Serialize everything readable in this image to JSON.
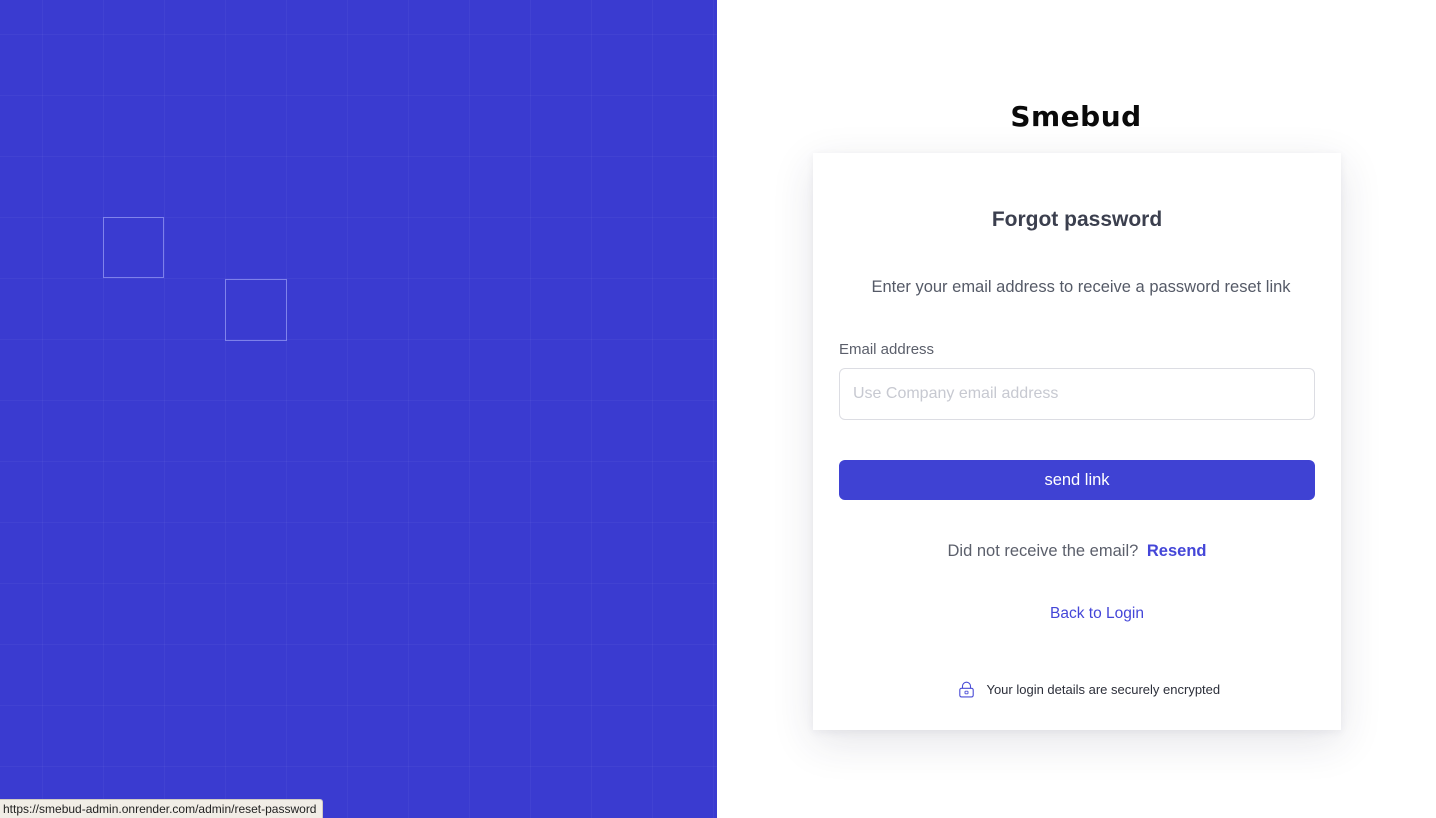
{
  "left_panel": {
    "status_url": "https://smebud-admin.onrender.com/admin/reset-password"
  },
  "brand": {
    "name": "Smebud"
  },
  "card": {
    "title": "Forgot password",
    "subtitle": "Enter your email address to receive a password reset link",
    "email_label": "Email address",
    "email_placeholder": "Use Company email address",
    "email_value": "",
    "send_label": "send link",
    "resend_prompt": "Did not receive the email?",
    "resend_label": "Resend",
    "back_label": "Back to Login",
    "secure_note": "Your login details are securely encrypted",
    "secure_icon": "lock-icon"
  },
  "colors": {
    "primary": "#3f42d3",
    "panel_bg": "#3a3bd0",
    "link": "#4446d8"
  }
}
